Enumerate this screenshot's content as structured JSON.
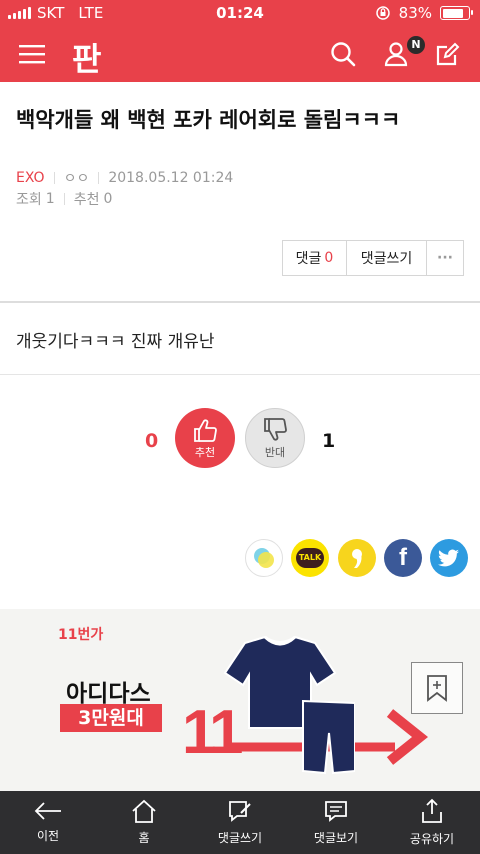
{
  "status": {
    "carrier": "SKT",
    "network": "LTE",
    "time": "01:24",
    "battery": "83%",
    "battery_level": 0.83
  },
  "app": {
    "logo": "판",
    "notification_badge": "N"
  },
  "post": {
    "title": "백악개들 왜 백현 포카 레어회로 돌림ㅋㅋㅋ",
    "category": "EXO",
    "author": "ㅇㅇ",
    "date": "2018.05.12 01:24",
    "views_label": "조회",
    "views": "1",
    "recommend_label": "추천",
    "recommend": "0",
    "body": "개웃기다ㅋㅋㅋ 진짜 개유난"
  },
  "actions": {
    "comment_label": "댓글",
    "comment_count": "0",
    "write_comment": "댓글쓰기",
    "more": "···"
  },
  "vote": {
    "up_count": "0",
    "up_label": "추천",
    "down_label": "반대",
    "down_count": "1"
  },
  "share": {
    "kakao_label": "TALK"
  },
  "ad": {
    "brand": "11번가",
    "title": "아디다스",
    "subtitle": "3만원대",
    "big_number": "11"
  },
  "bottom_nav": [
    {
      "label": "이전",
      "icon": "back-arrow-icon"
    },
    {
      "label": "홈",
      "icon": "home-icon"
    },
    {
      "label": "댓글쓰기",
      "icon": "write-comment-icon"
    },
    {
      "label": "댓글보기",
      "icon": "view-comment-icon"
    },
    {
      "label": "공유하기",
      "icon": "share-icon"
    }
  ],
  "colors": {
    "accent": "#e8414a",
    "bottom_bar": "#2e2e30"
  }
}
